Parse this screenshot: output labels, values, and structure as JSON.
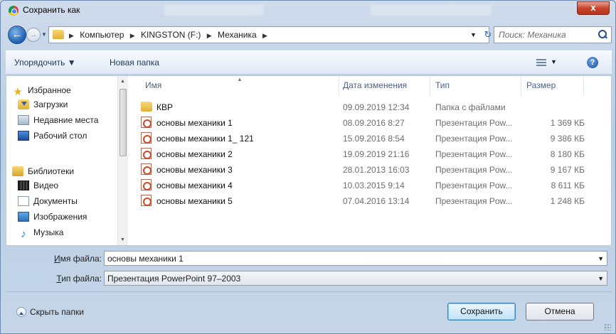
{
  "window": {
    "title": "Сохранить как",
    "close_label": "x"
  },
  "address_bar": {
    "breadcrumbs": [
      "Компьютер",
      "KINGSTON (F:)",
      "Механика"
    ],
    "search_placeholder": "Поиск: Механика"
  },
  "toolbar": {
    "organize_label": "Упорядочить ▼",
    "new_folder_label": "Новая папка",
    "help_label": "?"
  },
  "nav_pane": {
    "favorites": {
      "label": "Избранное",
      "items": [
        "Загрузки",
        "Недавние места",
        "Рабочий стол"
      ]
    },
    "libraries": {
      "label": "Библиотеки",
      "items": [
        "Видео",
        "Документы",
        "Изображения",
        "Музыка"
      ]
    }
  },
  "file_list": {
    "columns": {
      "name": "Имя",
      "date": "Дата изменения",
      "type": "Тип",
      "size": "Размер"
    },
    "rows": [
      {
        "icon": "folder-icon",
        "name": "КВР",
        "date": "09.09.2019 12:34",
        "type": "Папка с файлами",
        "size": ""
      },
      {
        "icon": "powerpoint-file-icon",
        "name": "основы механики 1",
        "date": "08.09.2016 8:27",
        "type": "Презентация Pow...",
        "size": "1 369 КБ"
      },
      {
        "icon": "powerpoint-file-icon",
        "name": "основы механики 1_ 121",
        "date": "15.09.2016 8:54",
        "type": "Презентация Pow...",
        "size": "9 386 КБ"
      },
      {
        "icon": "powerpoint-file-icon",
        "name": "основы механики 2",
        "date": "19.09.2019 21:16",
        "type": "Презентация Pow...",
        "size": "8 180 КБ"
      },
      {
        "icon": "powerpoint-file-icon",
        "name": "основы механики 3",
        "date": "28.01.2013 16:03",
        "type": "Презентация Pow...",
        "size": "9 167 КБ"
      },
      {
        "icon": "powerpoint-file-icon",
        "name": "основы механики 4",
        "date": "10.03.2015 9:14",
        "type": "Презентация Pow...",
        "size": "8 611 КБ"
      },
      {
        "icon": "powerpoint-file-icon",
        "name": "основы механики 5",
        "date": "07.04.2016 13:14",
        "type": "Презентация Pow...",
        "size": "1 248 КБ"
      }
    ]
  },
  "form": {
    "filename_label_accel": "И",
    "filename_label_rest": "мя файла:",
    "filename_value": "основы механики 1",
    "filetype_label_accel": "Т",
    "filetype_label_rest": "ип файла:",
    "filetype_value": "Презентация PowerPoint 97–2003"
  },
  "footer": {
    "hide_folders_label": "Скрыть папки",
    "save_label": "Сохранить",
    "cancel_label": "Отмена"
  },
  "colors": {
    "accent": "#3c7fb1",
    "close_button": "#c7442c"
  }
}
